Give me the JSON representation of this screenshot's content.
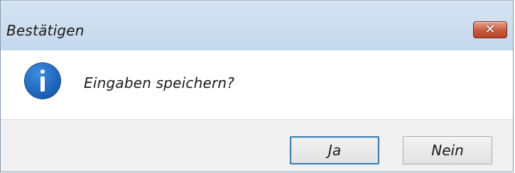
{
  "window": {
    "title": "Bestätigen",
    "close_label": "✕"
  },
  "content": {
    "icon": "info-icon",
    "message": "Eingaben speichern?"
  },
  "buttons": {
    "yes_label": "Ja",
    "no_label": "Nein"
  },
  "colors": {
    "titlebar": "#c9dcef",
    "close_button": "#c75a3f",
    "info_icon": "#1a5fb4",
    "footer": "#f0f0f0",
    "default_button_border": "#3c7fb1"
  }
}
